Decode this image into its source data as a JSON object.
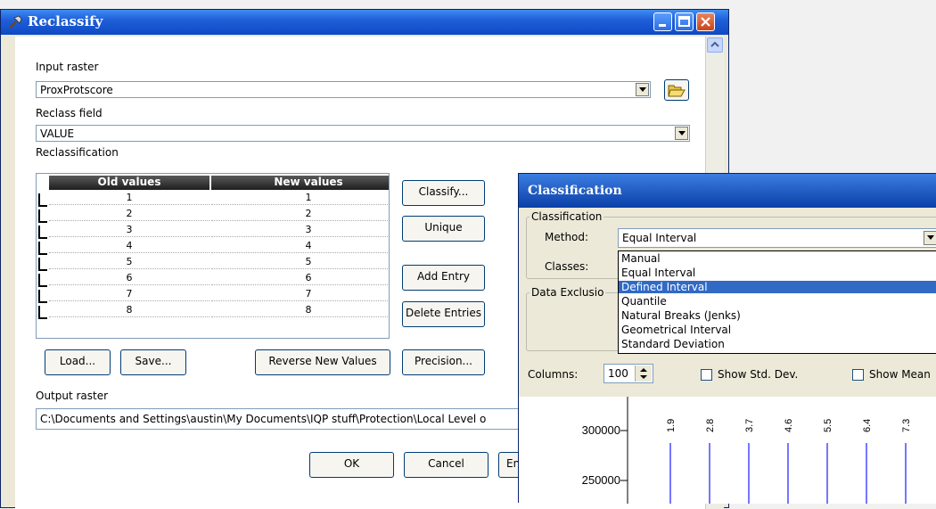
{
  "reclassify": {
    "title": "Reclassify",
    "input_raster_label": "Input raster",
    "input_raster_value": "ProxProtscore",
    "reclass_field_label": "Reclass field",
    "reclass_field_value": "VALUE",
    "reclassification_label": "Reclassification",
    "table": {
      "headers": [
        "Old values",
        "New values"
      ],
      "rows": [
        [
          "1",
          "1"
        ],
        [
          "2",
          "2"
        ],
        [
          "3",
          "3"
        ],
        [
          "4",
          "4"
        ],
        [
          "5",
          "5"
        ],
        [
          "6",
          "6"
        ],
        [
          "7",
          "7"
        ],
        [
          "8",
          "8"
        ]
      ]
    },
    "buttons": {
      "classify": "Classify...",
      "unique": "Unique",
      "add_entry": "Add Entry",
      "delete_entries": "Delete Entries",
      "load": "Load...",
      "save": "Save...",
      "reverse": "Reverse New Values",
      "precision": "Precision...",
      "ok": "OK",
      "cancel": "Cancel",
      "env": "En"
    },
    "output_raster_label": "Output raster",
    "output_raster_value": "C:\\Documents and Settings\\austin\\My Documents\\IQP stuff\\Protection\\Local Level o"
  },
  "classification": {
    "title": "Classification",
    "group_label": "Classification",
    "method_label": "Method:",
    "method_value": "Equal Interval",
    "classes_label": "Classes:",
    "methods": [
      "Manual",
      "Equal Interval",
      "Defined Interval",
      "Quantile",
      "Natural Breaks (Jenks)",
      "Geometrical Interval",
      "Standard Deviation"
    ],
    "selected_method_index": 2,
    "data_exclusion_label": "Data Exclusio",
    "columns_label": "Columns:",
    "columns_value": "100",
    "show_std_dev": "Show Std. Dev.",
    "show_mean": "Show Mean",
    "histogram": {
      "y_ticks": [
        "300000",
        "250000"
      ],
      "break_labels": [
        "1.9",
        "2.8",
        "3.7",
        "4.6",
        "5.5",
        "6.4",
        "7.3"
      ]
    }
  },
  "colors": {
    "title_blue": "#0f49c4",
    "selection": "#316ac5",
    "break_line": "#1a1aff"
  }
}
